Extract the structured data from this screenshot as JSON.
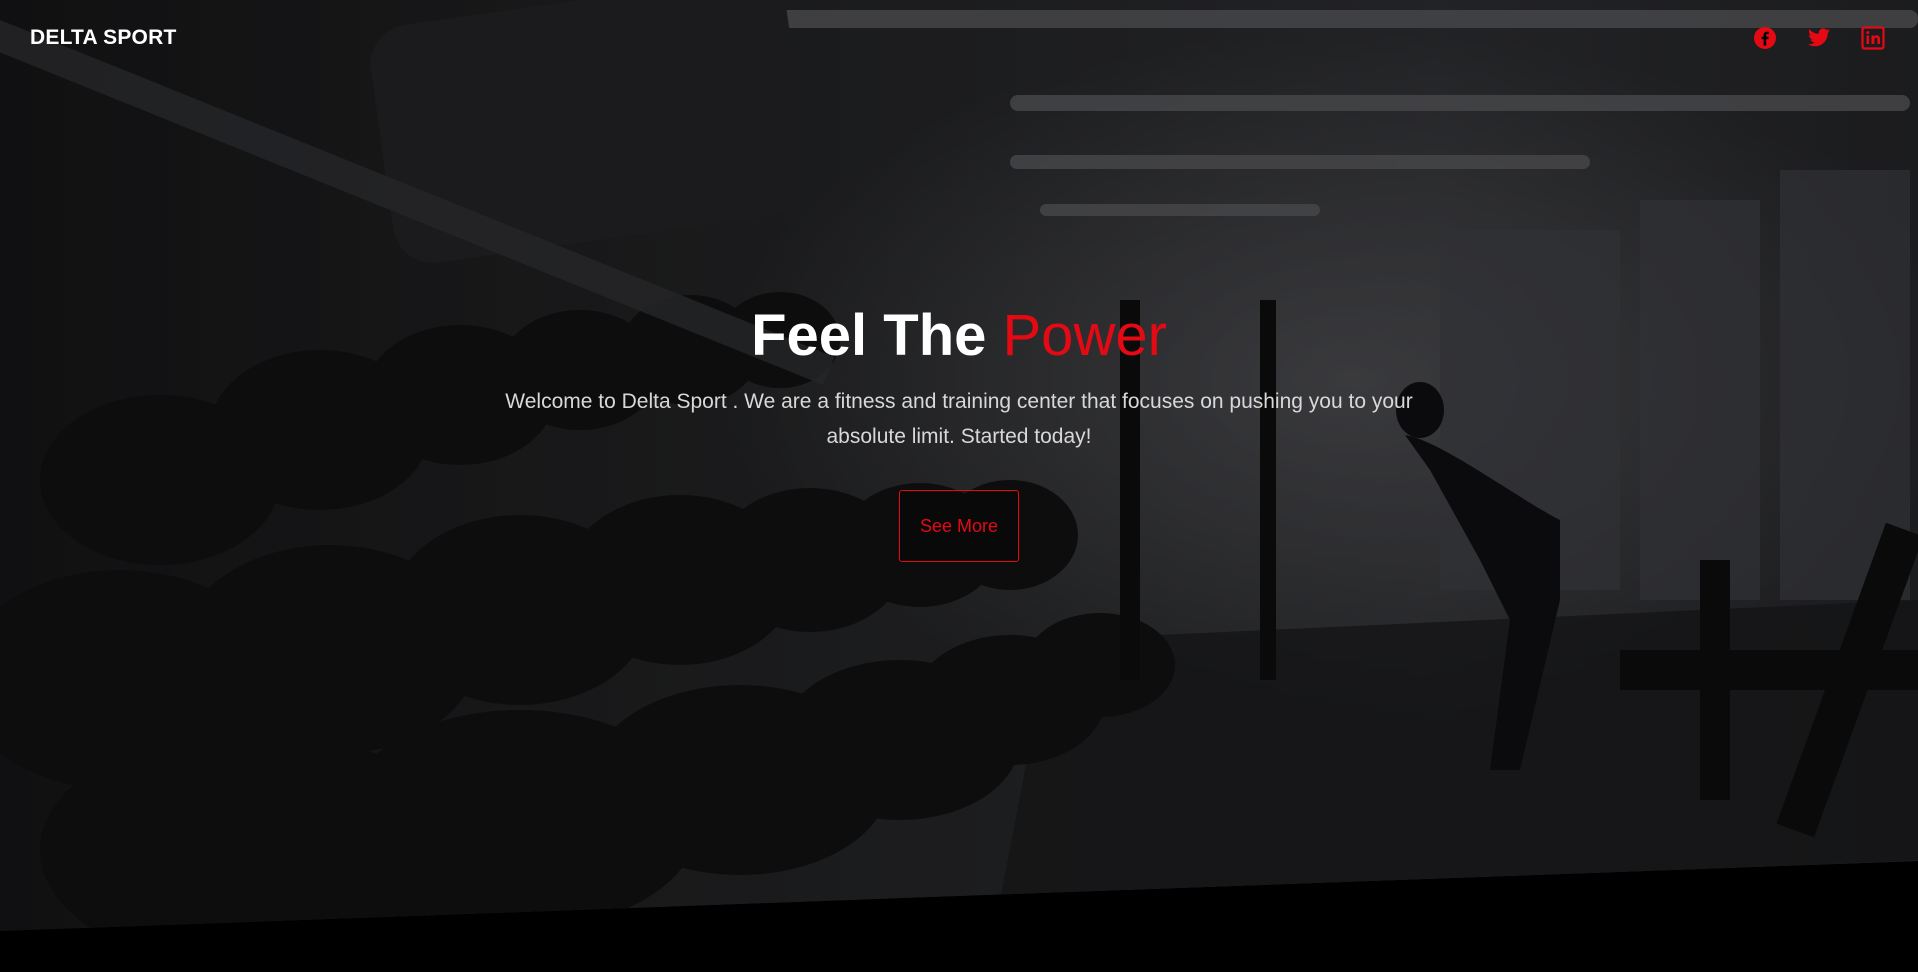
{
  "navbar": {
    "brand": "DELTA SPORT",
    "socials": [
      {
        "icon": "facebook-icon"
      },
      {
        "icon": "twitter-icon"
      },
      {
        "icon": "linkedin-icon"
      }
    ]
  },
  "hero": {
    "headline_main": "Feel The ",
    "headline_accent": "Power",
    "description": "Welcome to Delta Sport . We are a fitness and training center that focuses on pushing you to your absolute limit. Started today!",
    "cta_label": "See More"
  },
  "colors": {
    "accent": "#e50914",
    "text": "#ffffff",
    "background": "#000000"
  }
}
